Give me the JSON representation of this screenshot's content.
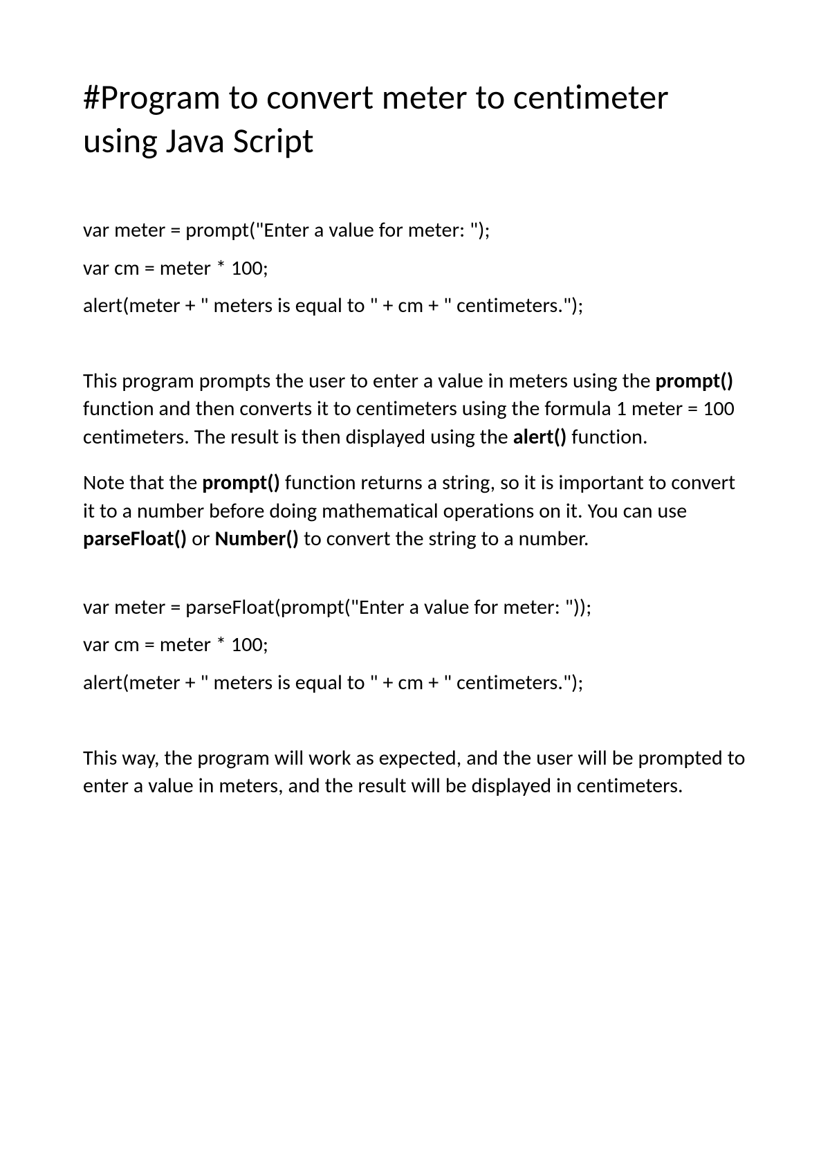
{
  "title": "#Program to convert meter to centimeter using Java Script",
  "code1": {
    "line1": "var meter = prompt(\"Enter a value for meter: \");",
    "line2": "var cm = meter * 100;",
    "line3": "alert(meter + \" meters is equal to \" + cm + \" centimeters.\");"
  },
  "para1": {
    "t1": "This program prompts the user to enter a value in meters using the ",
    "b1": "prompt()",
    "t2": " function and then converts it to centimeters using the formula 1 meter = 100 centimeters. The result is then displayed using the ",
    "b2": "alert()",
    "t3": " function."
  },
  "para2": {
    "t1": "Note that the ",
    "b1": "prompt()",
    "t2": " function returns a string, so it is important to convert it to a number before doing mathematical operations on it. You can use ",
    "b2": "parseFloat()",
    "t3": " or ",
    "b3": "Number()",
    "t4": " to convert the string to a number."
  },
  "code2": {
    "line1": "var meter = parseFloat(prompt(\"Enter a value for meter: \"));",
    "line2": "var cm = meter * 100;",
    "line3": "alert(meter + \" meters is equal to \" + cm + \" centimeters.\");"
  },
  "para3": "This way, the program will work as expected, and the user will be prompted to enter a value in meters, and the result will be displayed in centimeters."
}
